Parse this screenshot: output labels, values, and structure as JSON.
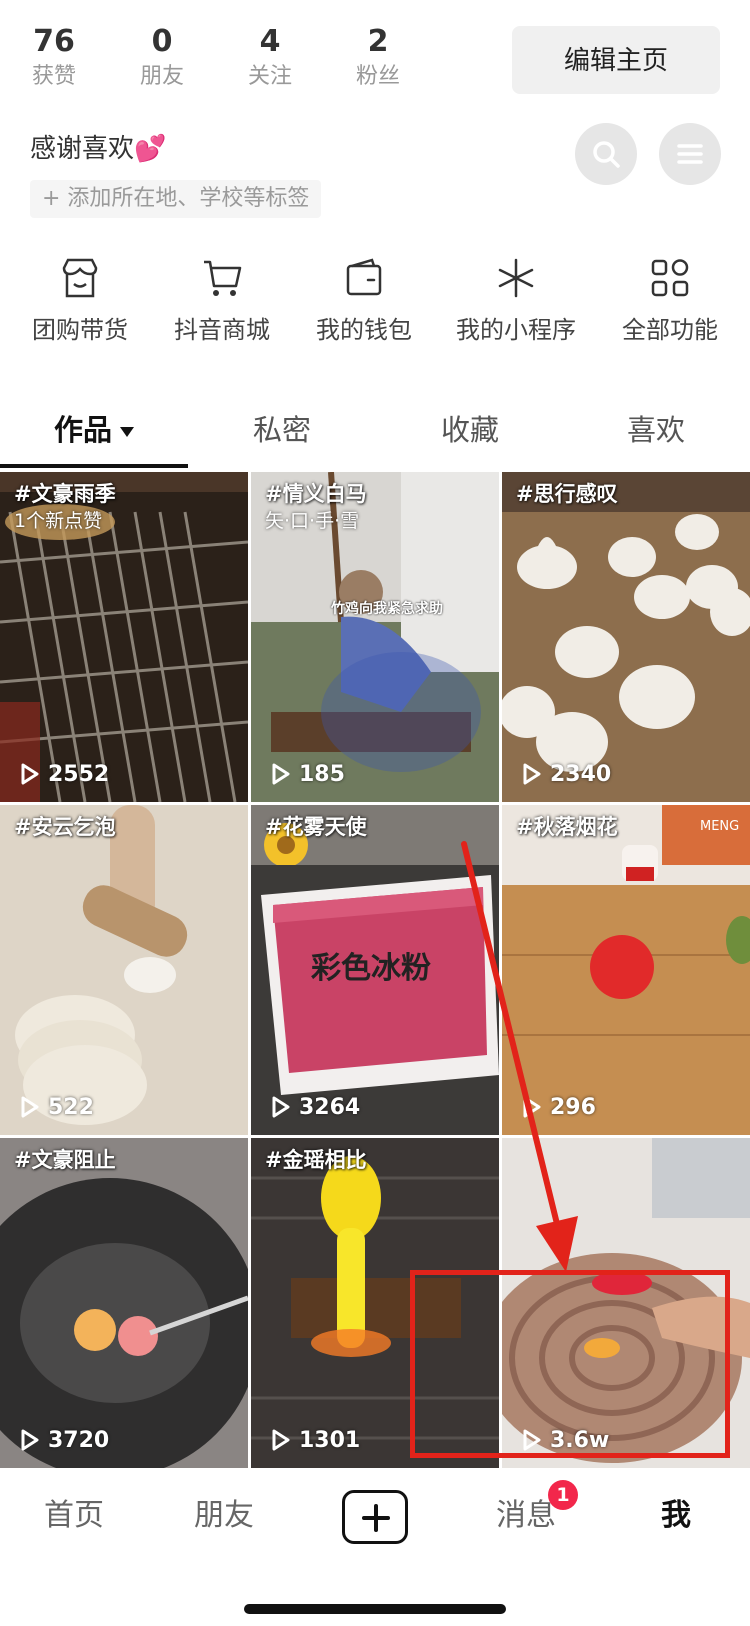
{
  "stats": [
    {
      "num": "76",
      "label": "获赞"
    },
    {
      "num": "0",
      "label": "朋友"
    },
    {
      "num": "4",
      "label": "关注"
    },
    {
      "num": "2",
      "label": "粉丝"
    }
  ],
  "edit_profile_label": "编辑主页",
  "bio": "感谢喜欢💕",
  "add_tag_label": "+ 添加所在地、学校等标签",
  "functions": [
    {
      "label": "团购带货",
      "icon": "shop-icon"
    },
    {
      "label": "抖音商城",
      "icon": "cart-icon"
    },
    {
      "label": "我的钱包",
      "icon": "wallet-icon"
    },
    {
      "label": "我的小程序",
      "icon": "mini-program-icon"
    },
    {
      "label": "全部功能",
      "icon": "grid-icon"
    }
  ],
  "tabs": [
    "作品",
    "私密",
    "收藏",
    "喜欢"
  ],
  "videos": [
    {
      "title": "#文豪雨季",
      "subtitle": "1个新点赞",
      "plays": "2552"
    },
    {
      "title": "#情义白马",
      "subtitle": "矢·口·手·雪",
      "plays": "185"
    },
    {
      "title": "#思行感叹",
      "subtitle": "",
      "plays": "2340"
    },
    {
      "title": "#安云乞泡",
      "subtitle": "",
      "plays": "522"
    },
    {
      "title": "#花雾天使",
      "subtitle": "",
      "plays": "3264"
    },
    {
      "title": "#秋落烟花",
      "subtitle": "",
      "plays": "296"
    },
    {
      "title": "#文豪阻止",
      "subtitle": "",
      "plays": "3720"
    },
    {
      "title": "#金瑶相比",
      "subtitle": "",
      "plays": "1301"
    },
    {
      "title": "",
      "subtitle": "",
      "plays": "3.6w"
    }
  ],
  "captions": {
    "c1": "竹鸡向我紧急求助",
    "c4": "彩色冰粉",
    "c5": "MENG"
  },
  "nav": {
    "home": "首页",
    "friends": "朋友",
    "messages": "消息",
    "me": "我",
    "badge": "1"
  },
  "colors": {
    "annotation": "#e2231a",
    "badge": "#f2274b"
  }
}
